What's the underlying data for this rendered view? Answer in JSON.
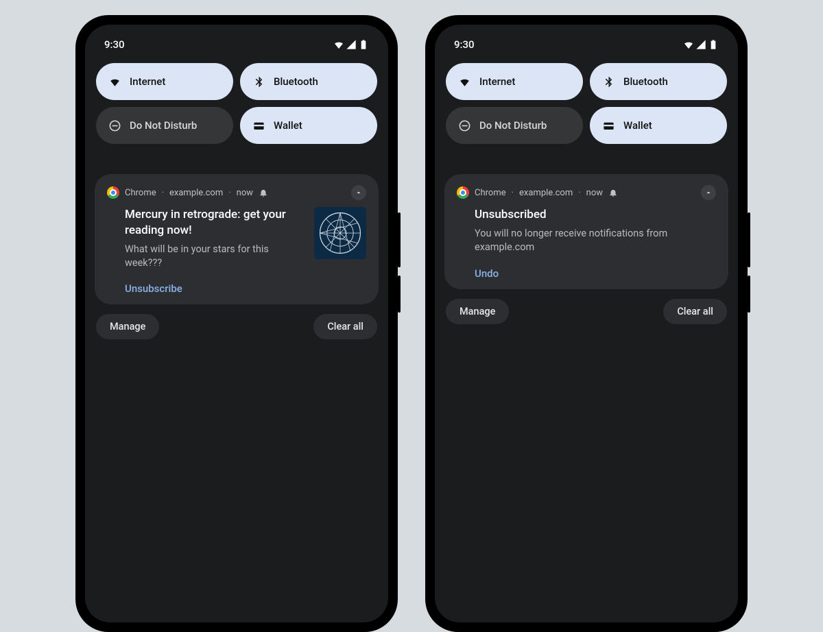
{
  "statusbar": {
    "time": "9:30"
  },
  "qs": {
    "internet": "Internet",
    "bluetooth": "Bluetooth",
    "dnd": "Do Not Disturb",
    "wallet": "Wallet"
  },
  "left": {
    "app": "Chrome",
    "site": "example.com",
    "time": "now",
    "title": "Mercury in retrograde: get your reading now!",
    "body": "What will be in your stars for this week???",
    "action": "Unsubscribe"
  },
  "right": {
    "app": "Chrome",
    "site": "example.com",
    "time": "now",
    "title": "Unsubscribed",
    "body": "You will no longer receive notifications from example.com",
    "action": "Undo"
  },
  "footer": {
    "manage": "Manage",
    "clear": "Clear all"
  },
  "colors": {
    "accent_tile": "#dbe5f5",
    "card_bg": "#2c2e31",
    "screen_bg": "#1a1c1e",
    "link": "#8bb2e8"
  }
}
